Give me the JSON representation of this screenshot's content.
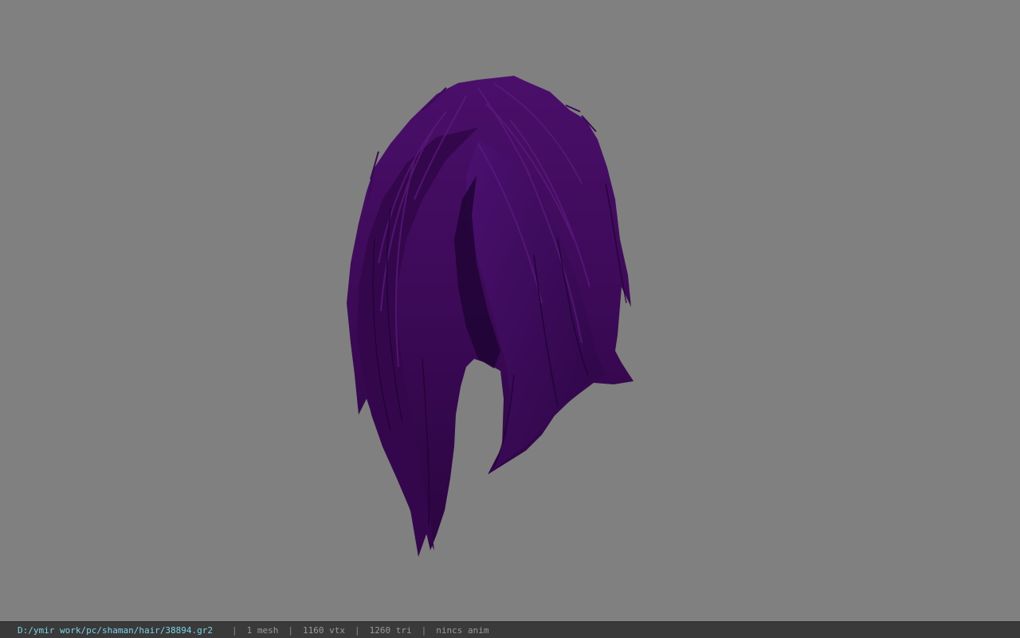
{
  "viewer": {
    "background_color": "#808080",
    "model_color": "#3d0a55",
    "model_highlight_color": "#5a1a78",
    "model_shadow_color": "#1e0330",
    "model_subject": "hair-mesh"
  },
  "status": {
    "file_path": "D:/ymir work/pc/shaman/hair/38894.gr2",
    "separator": "|",
    "mesh_count": "1 mesh",
    "vertex_count": "1160 vtx",
    "triangle_count": "1260 tri",
    "anim": "nincs anim"
  }
}
